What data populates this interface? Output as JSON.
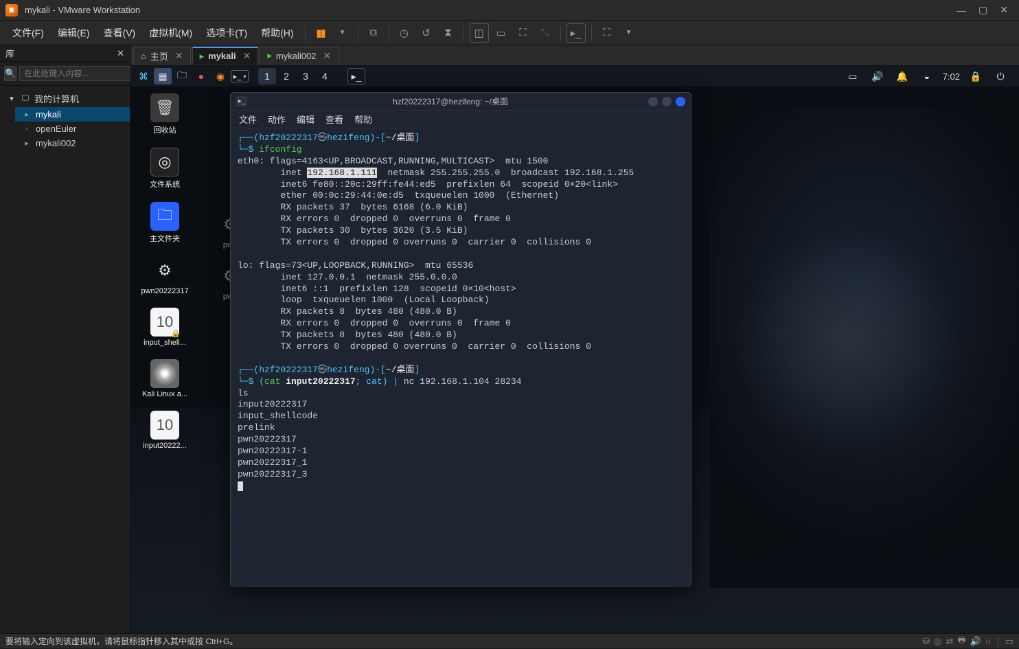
{
  "app": {
    "title": "mykali - VMware Workstation"
  },
  "menu": {
    "file": "文件(F)",
    "edit": "编辑(E)",
    "view": "查看(V)",
    "vm": "虚拟机(M)",
    "tabs": "选项卡(T)",
    "help": "帮助(H)"
  },
  "sidebar": {
    "title": "库",
    "search_placeholder": "在此处键入内容...",
    "root": "我的计算机",
    "items": {
      "0": {
        "label": "mykali"
      },
      "1": {
        "label": "openEuler"
      },
      "2": {
        "label": "mykali002"
      }
    }
  },
  "vmtabs": {
    "home": "主页",
    "t1": "mykali",
    "t2": "mykali002"
  },
  "kali": {
    "workspaces": {
      "0": "1",
      "1": "2",
      "2": "3",
      "3": "4"
    },
    "time": "7:02",
    "icons": {
      "trash": "回收站",
      "fs": "文件系统",
      "home": "主文件夹",
      "pwn1": "pwn20222317",
      "shell": "input_shell...",
      "iso": "Kali Linux a...",
      "input2": "input20222..."
    },
    "icons2": {
      "pwn_a": "pwn",
      "pwn_b": "pwn"
    }
  },
  "terminal": {
    "title": "hzf20222317@hezifeng: ~/桌面",
    "menu": {
      "file": "文件",
      "actions": "动作",
      "edit": "编辑",
      "view": "查看",
      "help": "帮助"
    },
    "prompt": {
      "user": "hzf20222317",
      "host": "hezifeng",
      "path": "~/桌面"
    },
    "cmd1": "ifconfig",
    "ifconfig": {
      "l1": "eth0: flags=4163<UP,BROADCAST,RUNNING,MULTICAST>  mtu 1500",
      "l2a": "        inet ",
      "l2_ip": "192.168.1.111",
      "l2b": "  netmask 255.255.255.0  broadcast 192.168.1.255",
      "l3": "        inet6 fe80::20c:29ff:fe44:ed5  prefixlen 64  scopeid 0×20<link>",
      "l4": "        ether 00:0c:29:44:0e:d5  txqueuelen 1000  (Ethernet)",
      "l5": "        RX packets 37  bytes 6168 (6.0 KiB)",
      "l6": "        RX errors 0  dropped 0  overruns 0  frame 0",
      "l7": "        TX packets 30  bytes 3620 (3.5 KiB)",
      "l8": "        TX errors 0  dropped 0 overruns 0  carrier 0  collisions 0",
      "l9": "",
      "l10": "lo: flags=73<UP,LOOPBACK,RUNNING>  mtu 65536",
      "l11": "        inet 127.0.0.1  netmask 255.0.0.0",
      "l12": "        inet6 ::1  prefixlen 128  scopeid 0×10<host>",
      "l13": "        loop  txqueuelen 1000  (Local Loopback)",
      "l14": "        RX packets 8  bytes 480 (480.0 B)",
      "l15": "        RX errors 0  dropped 0  overruns 0  frame 0",
      "l16": "        TX packets 8  bytes 480 (480.0 B)",
      "l17": "        TX errors 0  dropped 0 overruns 0  carrier 0  collisions 0"
    },
    "cmd2": {
      "p1": "(",
      "p2": "cat",
      "p3": " input20222317",
      "p4": "; cat)",
      "p5": " | ",
      "p6": "nc 192.168.1.104 28234"
    },
    "out": {
      "l1": "ls",
      "l2": "input20222317",
      "l3": "input_shellcode",
      "l4": "prelink",
      "l5": "pwn20222317",
      "l6": "pwn20222317-1",
      "l7": "pwn20222317_1",
      "l8": "pwn20222317_3"
    }
  },
  "statusbar": {
    "hint": "要将输入定向到该虚拟机，请将鼠标指针移入其中或按 Ctrl+G。"
  }
}
